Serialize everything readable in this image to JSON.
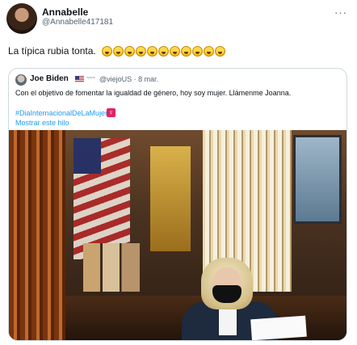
{
  "tweet": {
    "author_name": "Annabelle",
    "author_handle": "@Annabelle417181",
    "more_label": "···",
    "text": "La típica rubia tonta.",
    "emoji_count": 11,
    "emoji_name": "laughing-crying-emoji"
  },
  "quote": {
    "author_name": "Joe Biden",
    "handle_time": "@viejoUS · 8 mar.",
    "body": "Con el objetivo de fomentar la igualdad de género, hoy soy mujer. Llámenme Joanna.",
    "hashtag": "#DiaInternacionalDeLaMujer",
    "female_sign": "♀",
    "show_thread": "Mostrar este hilo"
  },
  "colors": {
    "link": "#1d9bf0",
    "muted": "#536471",
    "border": "#cfd9de"
  }
}
